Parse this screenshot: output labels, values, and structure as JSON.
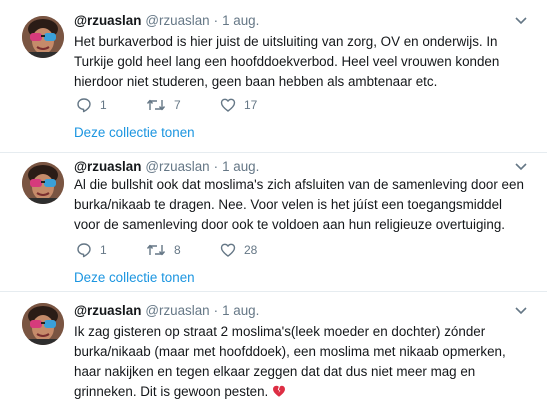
{
  "tweets": [
    {
      "name": "@rzuaslan",
      "handle": "@rzuaslan",
      "separator": "·",
      "date": "1 aug.",
      "lines": [
        "Het burkaverbod is hier juist de uitsluiting van zorg, OV en onderwijs. In",
        "Turkije gold heel lang een hoofddoekverbod. Heel veel vrouwen konden",
        "hierdoor niet studeren, geen baan hebben als ambtenaar etc."
      ],
      "replies": "1",
      "retweets": "7",
      "likes": "17",
      "collection_link": "Deze collectie tonen"
    },
    {
      "name": "@rzuaslan",
      "handle": "@rzuaslan",
      "separator": "·",
      "date": "1 aug.",
      "lines": [
        "Al die bullshit ook dat moslima's zich afsluiten van de samenleving door een",
        "burka/nikaab te dragen. Nee. Voor velen is het júíst een toegangsmiddel",
        "voor de samenleving door ook te voldoen aan hun religieuze overtuiging."
      ],
      "replies": "1",
      "retweets": "8",
      "likes": "28",
      "collection_link": "Deze collectie tonen"
    },
    {
      "name": "@rzuaslan",
      "handle": "@rzuaslan",
      "separator": "·",
      "date": "1 aug.",
      "lines": [
        "Ik zag gisteren op straat 2 moslima's(leek moeder en dochter) zónder",
        "burka/nikaab (maar met hoofddoek), een moslima met nikaab opmerken,",
        "haar nakijken en tegen elkaar zeggen dat dat dus niet meer mag en",
        "grinneken. Dit is gewoon pesten."
      ],
      "emoji": "broken-heart-icon"
    }
  ],
  "colors": {
    "link": "#1b95e0",
    "muted": "#657786",
    "text": "#14171a",
    "divider": "#e6ecf0",
    "broken_heart": "#dd2e44"
  }
}
